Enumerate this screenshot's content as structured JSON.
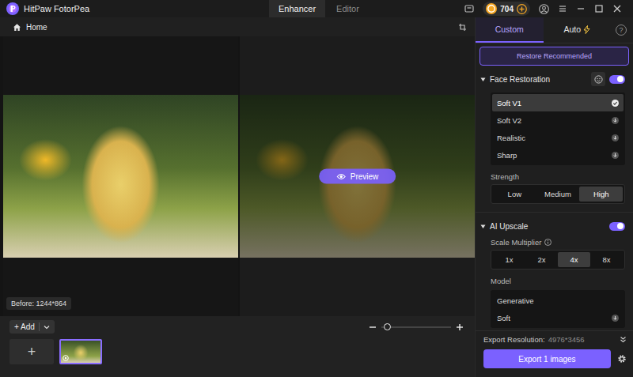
{
  "window": {
    "app_name": "HitPaw FotorPea",
    "tabs": [
      {
        "label": "Enhancer",
        "selected": true
      },
      {
        "label": "Editor",
        "selected": false
      }
    ],
    "credits": "704"
  },
  "toolbar": {
    "home_label": "Home"
  },
  "canvas": {
    "before_label": "Before: 1244*864",
    "preview_label": "Preview"
  },
  "bottom_bar": {
    "add_label": "+ Add",
    "zoom_level": 0.08,
    "thumbnails": [
      {
        "kind": "add",
        "label": "+",
        "selected": false
      },
      {
        "kind": "image",
        "selected": true
      }
    ]
  },
  "side_panel": {
    "tabs": [
      {
        "label": "Custom",
        "selected": true,
        "kind": "plain"
      },
      {
        "label": "Auto",
        "selected": false,
        "kind": "with-icon"
      }
    ],
    "help_icon": "?",
    "restore_button": "Restore Recommended",
    "face_restoration": {
      "title": "Face Restoration",
      "expanded": true,
      "on": true,
      "models": [
        {
          "label": "Soft V1",
          "selected": true,
          "kind": "installed"
        },
        {
          "label": "Soft V2",
          "selected": false,
          "kind": "download"
        },
        {
          "label": "Realistic",
          "selected": false,
          "kind": "download"
        },
        {
          "label": "Sharp",
          "selected": false,
          "kind": "download"
        }
      ],
      "strength": {
        "label": "Strength",
        "options": [
          {
            "label": "Low",
            "selected": false
          },
          {
            "label": "Medium",
            "selected": false
          },
          {
            "label": "High",
            "selected": true
          }
        ]
      }
    },
    "ai_upscale": {
      "title": "AI Upscale",
      "expanded": true,
      "on": true,
      "scale": {
        "label": "Scale Multiplier",
        "options": [
          {
            "label": "1x",
            "selected": false
          },
          {
            "label": "2x",
            "selected": false
          },
          {
            "label": "4x",
            "selected": true
          },
          {
            "label": "8x",
            "selected": false
          }
        ]
      },
      "model": {
        "label": "Model",
        "options": [
          {
            "label": "Generative",
            "kind": "installed",
            "selected": false
          },
          {
            "label": "Soft",
            "kind": "download",
            "selected": false
          }
        ]
      }
    },
    "export": {
      "resolution_label": "Export Resolution:",
      "resolution": "4976*3456",
      "button_label": "Export 1 images"
    }
  }
}
